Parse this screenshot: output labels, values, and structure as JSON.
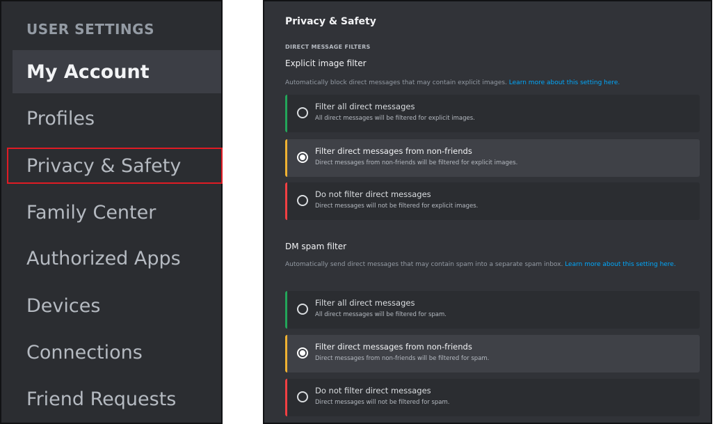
{
  "sidebar": {
    "heading": "USER SETTINGS",
    "items": [
      {
        "label": "My Account"
      },
      {
        "label": "Profiles"
      },
      {
        "label": "Privacy & Safety"
      },
      {
        "label": "Family Center"
      },
      {
        "label": "Authorized Apps"
      },
      {
        "label": "Devices"
      },
      {
        "label": "Connections"
      },
      {
        "label": "Friend Requests"
      }
    ]
  },
  "panel": {
    "title": "Privacy & Safety",
    "section_label": "DIRECT MESSAGE FILTERS",
    "explicit": {
      "title": "Explicit image filter",
      "description": "Automatically block direct messages that may contain explicit images.",
      "link": "Learn more about this setting here.",
      "options": [
        {
          "label": "Filter all direct messages",
          "sub": "All direct messages will be filtered for explicit images."
        },
        {
          "label": "Filter direct messages from non-friends",
          "sub": "Direct messages from non-friends will be filtered for explicit images."
        },
        {
          "label": "Do not filter direct messages",
          "sub": "Direct messages will not be filtered for explicit images."
        }
      ]
    },
    "spam": {
      "title": "DM spam filter",
      "description": "Automatically send direct messages that may contain spam into a separate spam inbox.",
      "link": "Learn more about this setting here.",
      "options": [
        {
          "label": "Filter all direct messages",
          "sub": "All direct messages will be filtered for spam."
        },
        {
          "label": "Filter direct messages from non-friends",
          "sub": "Direct messages from non-friends will be filtered for spam."
        },
        {
          "label": "Do not filter direct messages",
          "sub": "Direct messages will not be filtered for spam."
        }
      ]
    }
  },
  "colors": {
    "accent_link": "#00a8fc",
    "highlight_box": "#e01b24",
    "option_green": "#23a55a",
    "option_yellow": "#f0b232",
    "option_red": "#f23f43"
  }
}
